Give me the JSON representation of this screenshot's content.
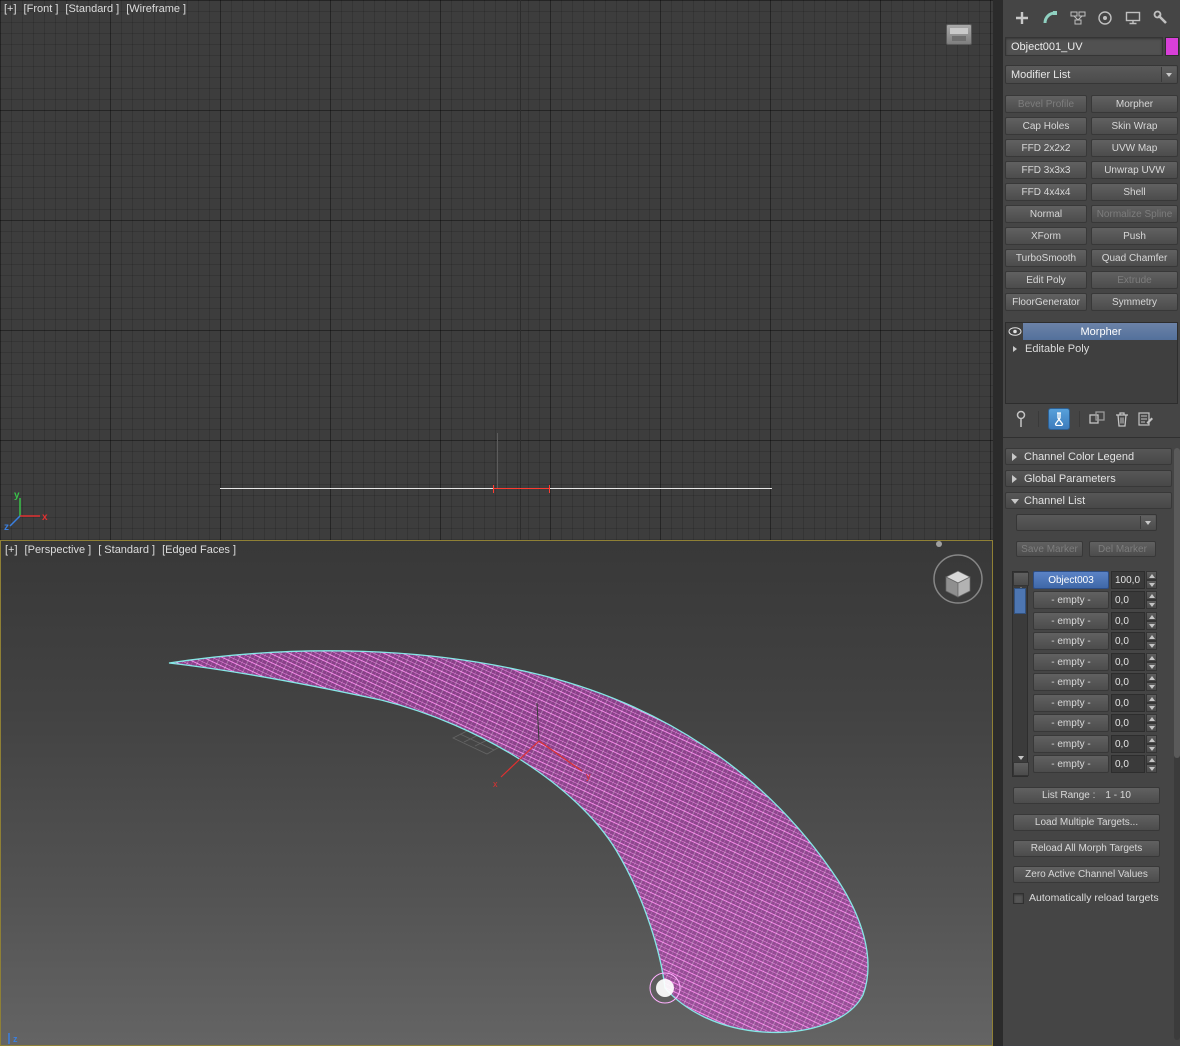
{
  "viewports": {
    "front": {
      "labels": [
        "[+]",
        "[Front ]",
        "[Standard ]",
        "[Wireframe ]"
      ]
    },
    "perspective": {
      "labels": [
        "[+]",
        "[Perspective ]",
        "[ Standard ]",
        "[Edged Faces ]"
      ]
    },
    "axis": {
      "x": "x",
      "y": "y",
      "z": "z"
    }
  },
  "panel": {
    "tab_icons": [
      "create-icon",
      "modify-icon",
      "hierarchy-icon",
      "motion-icon",
      "display-icon",
      "utilities-icon"
    ],
    "object_name": "Object001_UV",
    "modifier_list_label": "Modifier List",
    "modifier_buttons": [
      {
        "label": "Bevel Profile",
        "enabled": false
      },
      {
        "label": "Morpher",
        "enabled": true
      },
      {
        "label": "Cap Holes",
        "enabled": true
      },
      {
        "label": "Skin Wrap",
        "enabled": true
      },
      {
        "label": "FFD 2x2x2",
        "enabled": true
      },
      {
        "label": "UVW Map",
        "enabled": true
      },
      {
        "label": "FFD 3x3x3",
        "enabled": true
      },
      {
        "label": "Unwrap UVW",
        "enabled": true
      },
      {
        "label": "FFD 4x4x4",
        "enabled": true
      },
      {
        "label": "Shell",
        "enabled": true
      },
      {
        "label": "Normal",
        "enabled": true
      },
      {
        "label": "Normalize Spline",
        "enabled": false
      },
      {
        "label": "XForm",
        "enabled": true
      },
      {
        "label": "Push",
        "enabled": true
      },
      {
        "label": "TurboSmooth",
        "enabled": true
      },
      {
        "label": "Quad Chamfer",
        "enabled": true
      },
      {
        "label": "Edit Poly",
        "enabled": true
      },
      {
        "label": "Extrude",
        "enabled": false
      },
      {
        "label": "FloorGenerator",
        "enabled": true
      },
      {
        "label": "Symmetry",
        "enabled": true
      }
    ],
    "stack": {
      "rows": [
        {
          "name": "Morpher",
          "selected": true
        },
        {
          "name": "Editable Poly",
          "selected": false
        }
      ]
    },
    "rollouts": {
      "channel_color_legend": "Channel Color Legend",
      "global_parameters": "Global Parameters",
      "channel_list": "Channel List"
    },
    "markers": {
      "save": "Save Marker",
      "del": "Del Marker"
    },
    "channel_list": {
      "rows": [
        {
          "name": "Object003",
          "value": "100,0",
          "selected": true
        },
        {
          "name": "- empty -",
          "value": "0,0",
          "selected": false
        },
        {
          "name": "- empty -",
          "value": "0,0",
          "selected": false
        },
        {
          "name": "- empty -",
          "value": "0,0",
          "selected": false
        },
        {
          "name": "- empty -",
          "value": "0,0",
          "selected": false
        },
        {
          "name": "- empty -",
          "value": "0,0",
          "selected": false
        },
        {
          "name": "- empty -",
          "value": "0,0",
          "selected": false
        },
        {
          "name": "- empty -",
          "value": "0,0",
          "selected": false
        },
        {
          "name": "- empty -",
          "value": "0,0",
          "selected": false
        },
        {
          "name": "- empty -",
          "value": "0,0",
          "selected": false
        }
      ],
      "list_range_label": "List Range :",
      "list_range_value": "1 - 10",
      "buttons": [
        "Load Multiple Targets...",
        "Reload All Morph Targets",
        "Zero Active Channel Values"
      ],
      "checkbox_label": "Automatically reload targets"
    },
    "colors": {
      "object_color": "#d83fd8",
      "selection_blue": "#4a74b8",
      "mesh_magenta": "#cf4fcf",
      "edge_cyan": "#86e8e6"
    }
  }
}
